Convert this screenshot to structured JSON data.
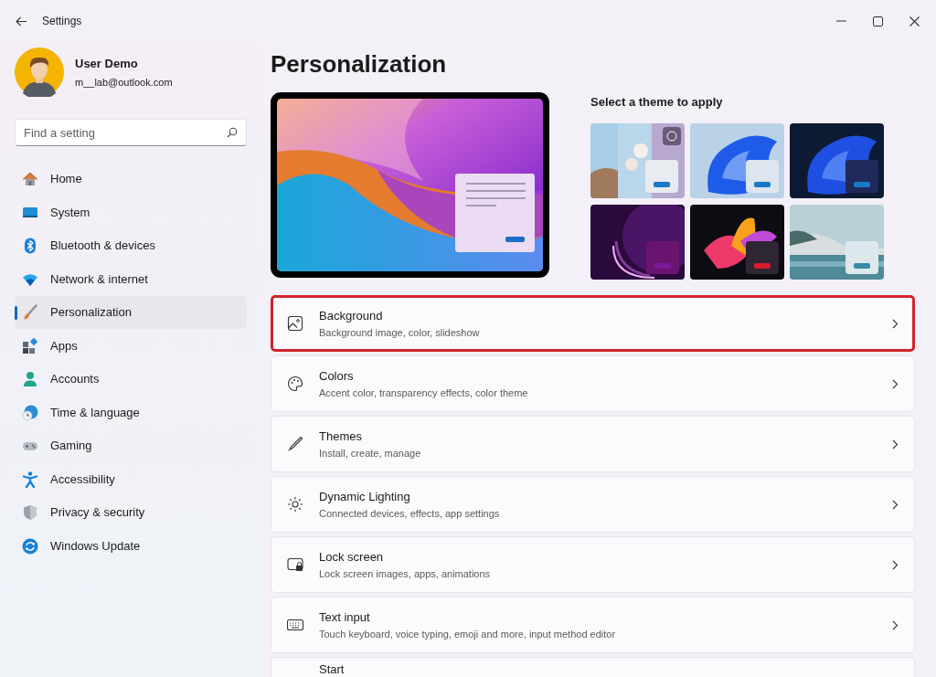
{
  "window": {
    "title": "Settings"
  },
  "user": {
    "name": "User Demo",
    "email": "m__lab@outlook.com"
  },
  "search": {
    "placeholder": "Find a setting"
  },
  "nav": [
    {
      "label": "Home",
      "selected": false
    },
    {
      "label": "System",
      "selected": false
    },
    {
      "label": "Bluetooth & devices",
      "selected": false
    },
    {
      "label": "Network & internet",
      "selected": false
    },
    {
      "label": "Personalization",
      "selected": true
    },
    {
      "label": "Apps",
      "selected": false
    },
    {
      "label": "Accounts",
      "selected": false
    },
    {
      "label": "Time & language",
      "selected": false
    },
    {
      "label": "Gaming",
      "selected": false
    },
    {
      "label": "Accessibility",
      "selected": false
    },
    {
      "label": "Privacy & security",
      "selected": false
    },
    {
      "label": "Windows Update",
      "selected": false
    }
  ],
  "page_title": "Personalization",
  "themes": {
    "heading": "Select a theme to apply"
  },
  "cards": [
    {
      "title": "Background",
      "subtitle": "Background image, color, slideshow",
      "highlighted": true
    },
    {
      "title": "Colors",
      "subtitle": "Accent color, transparency effects, color theme",
      "highlighted": false
    },
    {
      "title": "Themes",
      "subtitle": "Install, create, manage",
      "highlighted": false
    },
    {
      "title": "Dynamic Lighting",
      "subtitle": "Connected devices, effects, app settings",
      "highlighted": false
    },
    {
      "title": "Lock screen",
      "subtitle": "Lock screen images, apps, animations",
      "highlighted": false
    },
    {
      "title": "Text input",
      "subtitle": "Touch keyboard, voice typing, emoji and more, input method editor",
      "highlighted": false
    },
    {
      "title": "Start",
      "highlighted": false
    }
  ]
}
